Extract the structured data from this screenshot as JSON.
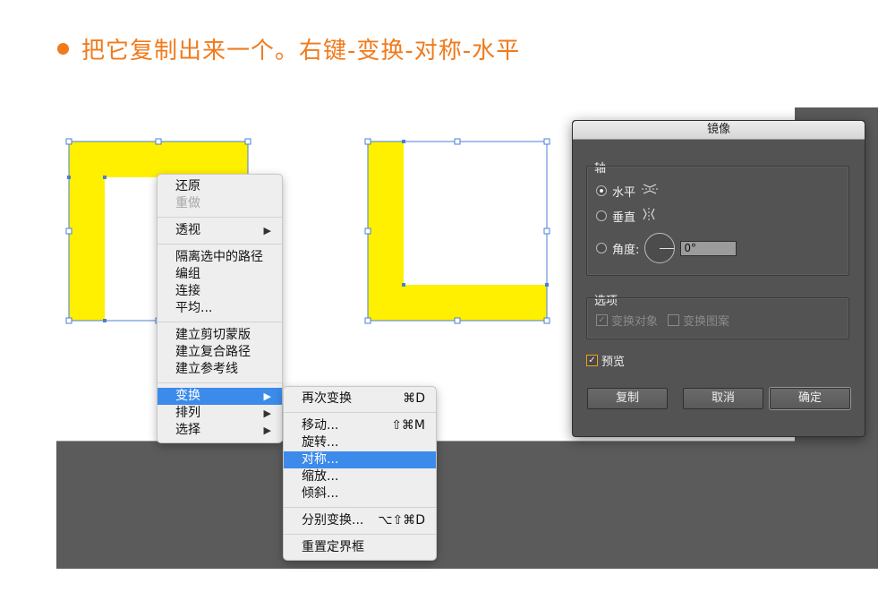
{
  "caption": {
    "text": "把它复制出来一个。右键-变换-对称-水平"
  },
  "context_menu": {
    "groups": [
      [
        {
          "label": "还原",
          "disabled": false
        },
        {
          "label": "重做",
          "disabled": true
        }
      ],
      [
        {
          "label": "透视",
          "submenu": true
        }
      ],
      [
        {
          "label": "隔离选中的路径"
        },
        {
          "label": "编组"
        },
        {
          "label": "连接"
        },
        {
          "label": "平均..."
        }
      ],
      [
        {
          "label": "建立剪切蒙版"
        },
        {
          "label": "建立复合路径"
        },
        {
          "label": "建立参考线"
        }
      ],
      [
        {
          "label": "变换",
          "submenu": true,
          "active": true
        },
        {
          "label": "排列",
          "submenu": true
        },
        {
          "label": "选择",
          "submenu": true
        }
      ]
    ]
  },
  "transform_submenu": {
    "items": [
      {
        "label": "再次变换",
        "shortcut": "⌘D"
      },
      {
        "label": "移动...",
        "shortcut": "⇧⌘M"
      },
      {
        "label": "旋转..."
      },
      {
        "label": "对称...",
        "active": true
      },
      {
        "label": "缩放..."
      },
      {
        "label": "倾斜..."
      },
      {
        "label": "分别变换...",
        "shortcut": "⌥⇧⌘D"
      },
      {
        "label": "重置定界框"
      }
    ]
  },
  "mirror_dialog": {
    "title": "镜像",
    "axis_group": "轴",
    "horizontal": "水平",
    "vertical": "垂直",
    "angle_label": "角度:",
    "angle_value": "0°",
    "options_group": "选项",
    "transform_objects": "变换对象",
    "transform_patterns": "变换图案",
    "preview": "预览",
    "copy_button": "复制",
    "cancel_button": "取消",
    "ok_button": "确定"
  },
  "colors": {
    "accent_orange": "#f07b1d",
    "shape_yellow": "#fff000",
    "selection_blue": "#4a7fd8",
    "menu_highlight": "#3c8bea"
  }
}
